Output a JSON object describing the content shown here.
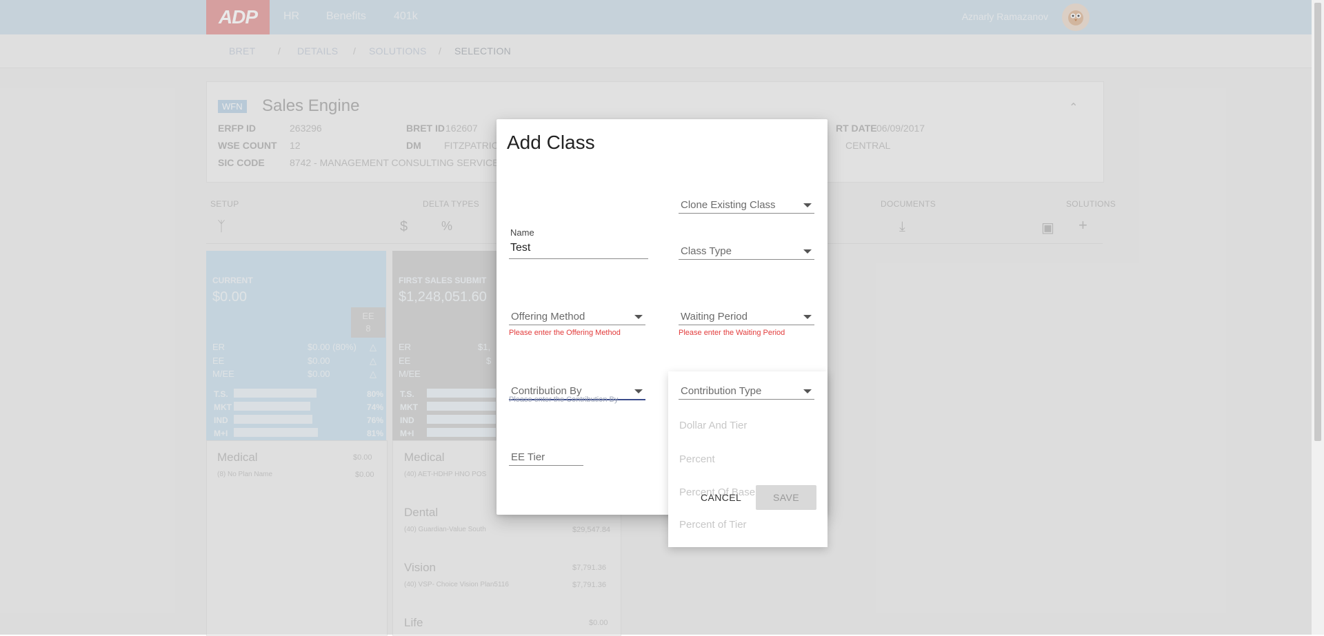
{
  "topbar": {
    "logo": "ADP",
    "nav": [
      "HR",
      "Benefits",
      "401k"
    ],
    "user_name": "Aznarly Ramazanov"
  },
  "breadcrumb": [
    "BRET",
    "DETAILS",
    "SOLUTIONS",
    "SELECTION"
  ],
  "breadcrumb_sep": "/",
  "summary": {
    "badge": "WFN",
    "title": "Sales Engine",
    "fields": {
      "erfp_id_label": "ERFP ID",
      "erfp_id": "263296",
      "wse_count_label": "WSE COUNT",
      "wse_count": "12",
      "sic_code_label": "SIC CODE",
      "sic_code": "8742 - MANAGEMENT CONSULTING SERVICES",
      "bret_id_label": "BRET ID",
      "bret_id": "162607",
      "dm_label": "DM",
      "dm": "FITZPATRIC",
      "start_date_label": "RT DATE",
      "start_date": "06/09/2017",
      "region": "CENTRAL"
    }
  },
  "sections": {
    "setup": "SETUP",
    "delta_types": "DELTA TYPES",
    "documents": "DOCUMENTS",
    "solutions": "SOLUTIONS"
  },
  "current_col": {
    "head": "CURRENT",
    "amount": "$0.00",
    "ee_label": "EE",
    "ee_value": "8",
    "rows": [
      {
        "label": "ER",
        "value": "$0.00 (80%)"
      },
      {
        "label": "EE",
        "value": "$0.00"
      },
      {
        "label": "M/EE",
        "value": "$0.00"
      }
    ],
    "bars": [
      {
        "label": "T.S.",
        "pct": "80%",
        "fill": 0.8
      },
      {
        "label": "MKT",
        "pct": "74%",
        "fill": 0.74
      },
      {
        "label": "IND",
        "pct": "76%",
        "fill": 0.76
      },
      {
        "label": "M+I",
        "pct": "81%",
        "fill": 0.81
      }
    ],
    "plans": [
      {
        "title": "Medical",
        "sub": "(8) No Plan Name",
        "amt1": "$0.00",
        "amt2": "$0.00"
      }
    ]
  },
  "first_col": {
    "head": "FIRST SALES SUBMIT",
    "amount": "$1,248,051.60",
    "rows": [
      {
        "label": "ER",
        "value": "$1,"
      },
      {
        "label": "EE",
        "value": "$"
      },
      {
        "label": "M/EE",
        "value": ""
      }
    ],
    "bars": [
      {
        "label": "T.S."
      },
      {
        "label": "MKT"
      },
      {
        "label": "IND"
      },
      {
        "label": "M+I"
      }
    ],
    "plans": [
      {
        "title": "Medical",
        "sub": "(40) AET-HDHP HNO POS",
        "amt1": "",
        "amt2": ""
      },
      {
        "title": "Dental",
        "sub": "(40) Guardian-Value South",
        "amt1": "",
        "amt2": "$29,547.84"
      },
      {
        "title": "Vision",
        "sub": "(40) VSP- Choice Vision Plan5116",
        "amt1": "$7,791.36",
        "amt2": "$7,791.36"
      },
      {
        "title": "Life",
        "sub": "",
        "amt1": "$0.00",
        "amt2": ""
      }
    ]
  },
  "dialog": {
    "title": "Add Class",
    "clone_existing_class": "Clone Existing Class",
    "name_label": "Name",
    "name_value": "Test",
    "class_type": "Class Type",
    "offering_method": "Offering Method",
    "offering_method_error": "Please enter the Offering Method",
    "waiting_period": "Waiting Period",
    "waiting_period_error": "Please enter the Waiting Period",
    "contribution_by": "Contribution By",
    "contribution_by_error": "Please enter the Contribution By",
    "contribution_type": "Contribution Type",
    "ee_tier": "EE Tier",
    "cancel": "CANCEL",
    "save": "SAVE"
  },
  "contribution_type_menu": {
    "options": [
      "Dollar And Tier",
      "Percent",
      "Percent Of Base",
      "Percent of Tier"
    ]
  }
}
